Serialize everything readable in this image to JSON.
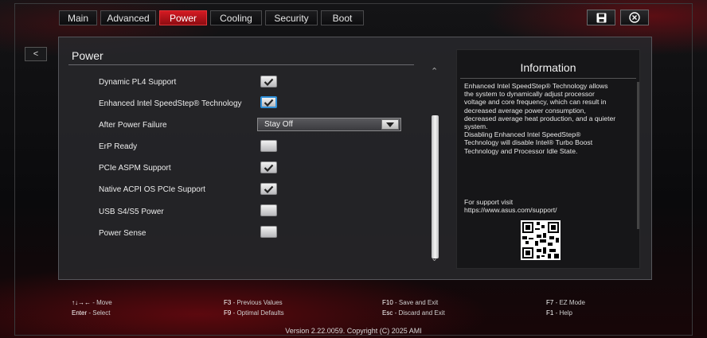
{
  "tabs": [
    {
      "label": "Main",
      "active": false
    },
    {
      "label": "Advanced",
      "active": false
    },
    {
      "label": "Power",
      "active": true
    },
    {
      "label": "Cooling",
      "active": false
    },
    {
      "label": "Security",
      "active": false
    },
    {
      "label": "Boot",
      "active": false
    }
  ],
  "nav": {
    "back_label": "<"
  },
  "section": {
    "title": "Power"
  },
  "settings": [
    {
      "label": "Dynamic PL4 Support",
      "checked": true
    },
    {
      "label": "Enhanced Intel SpeedStep® Technology",
      "checked": true
    },
    {
      "label": "After Power Failure",
      "value": "Stay Off"
    },
    {
      "label": "ErP Ready",
      "checked": false
    },
    {
      "label": "PCIe ASPM Support",
      "checked": true
    },
    {
      "label": "Native ACPI OS PCIe Support",
      "checked": true
    },
    {
      "label": "USB S4/S5 Power",
      "checked": false
    },
    {
      "label": "Power Sense",
      "checked": false
    }
  ],
  "info": {
    "title": "Information",
    "text_lines": [
      "Enhanced Intel SpeedStep® Technology allows",
      "the system to dynamically adjust processor",
      "voltage and core frequency, which can result in",
      "decreased average power consumption,",
      "decreased average heat production, and a quieter",
      "system.",
      "Disabling Enhanced Intel SpeedStep®",
      "Technology will disable Intel® Turbo Boost",
      "Technology and Processor Idle State."
    ],
    "support_label": "For support visit",
    "support_url": "https://www.asus.com/support/"
  },
  "hotkeys": [
    {
      "key": "↑↓→←",
      "desc": " - Move"
    },
    {
      "key": "Enter",
      "desc": " - Select"
    },
    {
      "key": "F3",
      "desc": " - Previous Values"
    },
    {
      "key": "F9",
      "desc": " - Optimal Defaults"
    },
    {
      "key": "F10",
      "desc": " - Save and Exit"
    },
    {
      "key": "Esc",
      "desc": " - Discard and Exit"
    },
    {
      "key": "F7",
      "desc": " - EZ Mode"
    },
    {
      "key": "F1",
      "desc": " - Help"
    }
  ],
  "footer": {
    "version": "Version 2.22.0059. Copyright (C) 2025 AMI"
  },
  "icons": {
    "save": "save-icon",
    "close": "close-icon"
  },
  "colors": {
    "accent": "#d41a22",
    "focus": "#2f8fd8"
  }
}
